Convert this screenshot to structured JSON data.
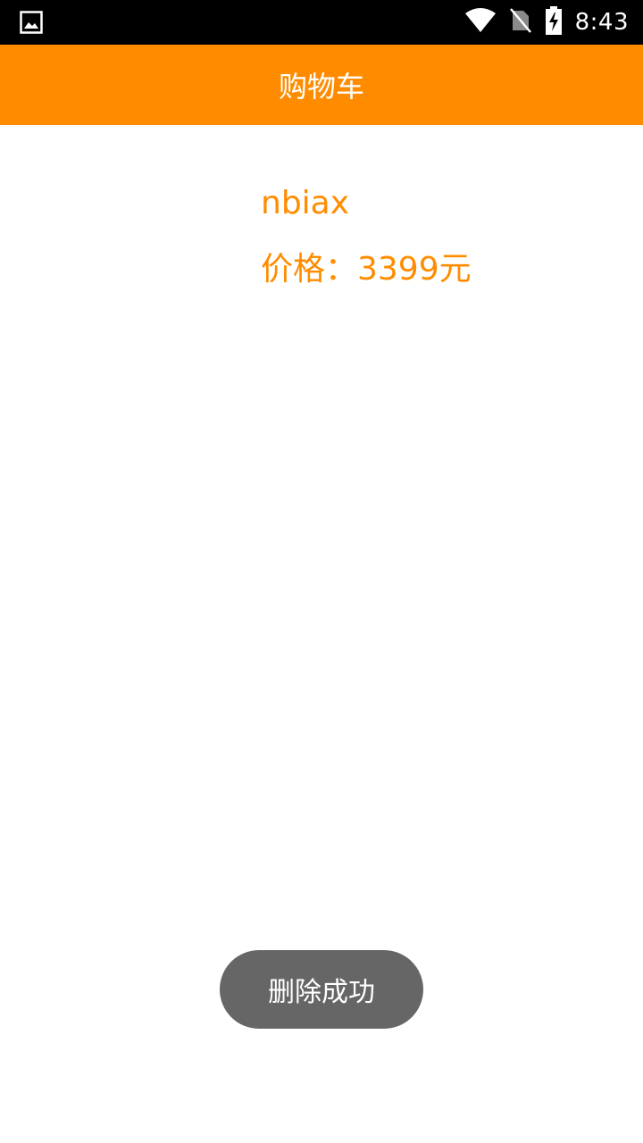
{
  "status_bar": {
    "time": "8:43",
    "icons": [
      "image-notification-icon",
      "wifi-icon",
      "no-sim-icon",
      "battery-charging-icon"
    ]
  },
  "app_bar": {
    "title": "购物车",
    "color": "#ff8c00"
  },
  "cart": {
    "items": [
      {
        "name": "nbiax",
        "price_text": "价格：3399元"
      }
    ]
  },
  "toast": {
    "message": "删除成功"
  }
}
